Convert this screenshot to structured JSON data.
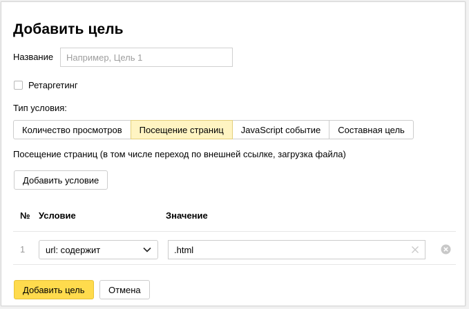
{
  "dialog": {
    "title": "Добавить цель",
    "name_label": "Название",
    "name_placeholder": "Например, Цель 1",
    "name_value": "",
    "retargeting_label": "Ретаргетинг",
    "retargeting_checked": false,
    "condition_type_label": "Тип условия:",
    "condition_types": [
      {
        "label": "Количество просмотров",
        "active": false
      },
      {
        "label": "Посещение страниц",
        "active": true
      },
      {
        "label": "JavaScript событие",
        "active": false
      },
      {
        "label": "Составная цель",
        "active": false
      }
    ],
    "description": "Посещение страниц (в том числе переход по внешней ссылке, загрузка файла)",
    "add_condition_label": "Добавить условие",
    "table": {
      "headers": {
        "num": "№",
        "condition": "Условие",
        "value": "Значение"
      },
      "rows": [
        {
          "num": "1",
          "condition": "url: содержит",
          "value": ".html"
        }
      ]
    },
    "submit_label": "Добавить цель",
    "cancel_label": "Отмена"
  },
  "colors": {
    "active_segment": "#fff4c2",
    "primary_button": "#ffdb4d"
  }
}
